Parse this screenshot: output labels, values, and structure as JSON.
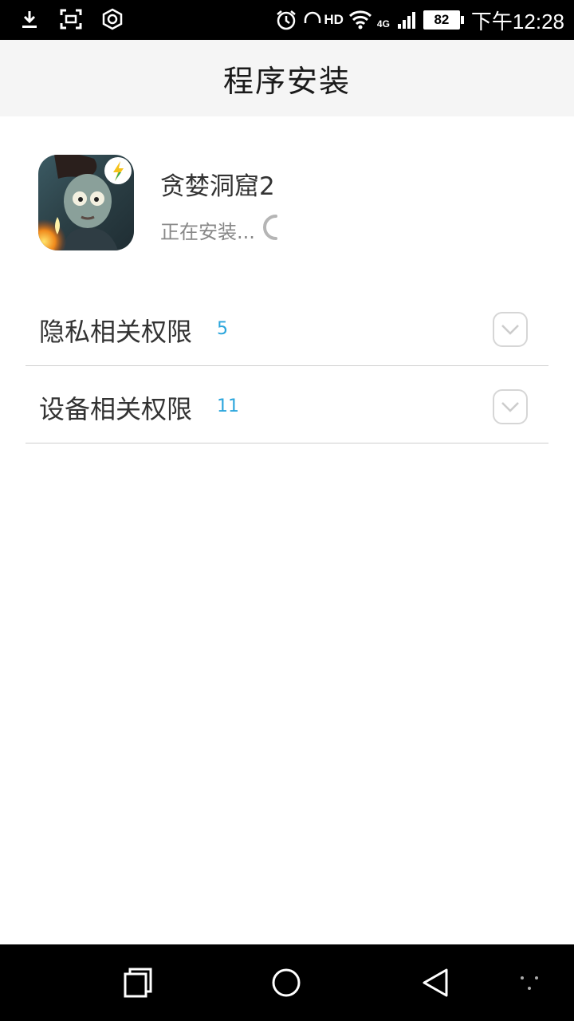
{
  "status_bar": {
    "left_icons": [
      "download-icon",
      "screenshot-icon",
      "hexagon-settings-icon"
    ],
    "right_icons": [
      "alarm-icon",
      "headset-icon",
      "wifi-icon",
      "signal-icon",
      "battery-icon"
    ],
    "hd_label": "HD",
    "network_label": "4G",
    "battery_level": "82",
    "time": "下午12:28"
  },
  "header": {
    "title": "程序安装"
  },
  "app": {
    "name": "贪婪洞窟2",
    "status": "正在安装..."
  },
  "permissions": [
    {
      "label": "隐私相关权限",
      "count": "5"
    },
    {
      "label": "设备相关权限",
      "count": "11"
    }
  ],
  "colors": {
    "accent": "#2aa5dc",
    "title_bar_bg": "#f5f5f5",
    "divider": "#cfcfcf"
  },
  "nav_bar": {
    "buttons": [
      "recent-apps-icon",
      "home-icon",
      "back-icon",
      "menu-dots-icon"
    ]
  }
}
